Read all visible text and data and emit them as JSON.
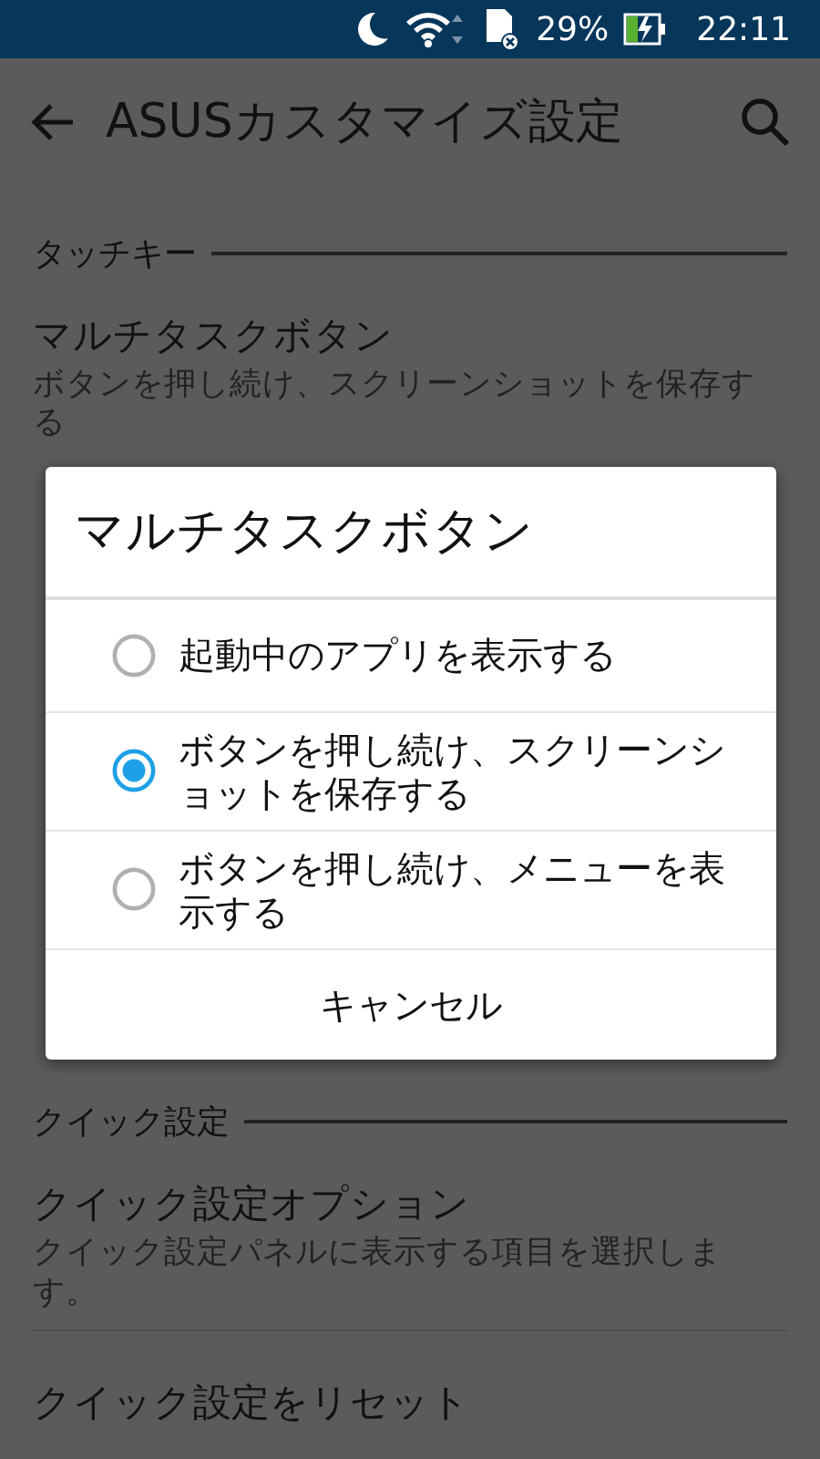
{
  "status_bar": {
    "battery_percent": "29%",
    "time": "22:11"
  },
  "toolbar": {
    "title": "ASUSカスタマイズ設定"
  },
  "sections": [
    {
      "header": "タッチキー",
      "items": [
        {
          "title": "マルチタスクボタン",
          "summary": "ボタンを押し続け、スクリーンショットを保存する"
        }
      ]
    },
    {
      "header": "クイック設定",
      "items": [
        {
          "title": "クイック設定オプション",
          "summary": "クイック設定パネルに表示する項目を選択します。"
        },
        {
          "title": "クイック設定をリセット"
        }
      ]
    }
  ],
  "dialog": {
    "title": "マルチタスクボタン",
    "options": [
      {
        "label": "起動中のアプリを表示する",
        "selected": false
      },
      {
        "label": "ボタンを押し続け、スクリーンショットを保存する",
        "selected": true
      },
      {
        "label": "ボタンを押し続け、メニューを表示する",
        "selected": false
      }
    ],
    "cancel": "キャンセル"
  }
}
